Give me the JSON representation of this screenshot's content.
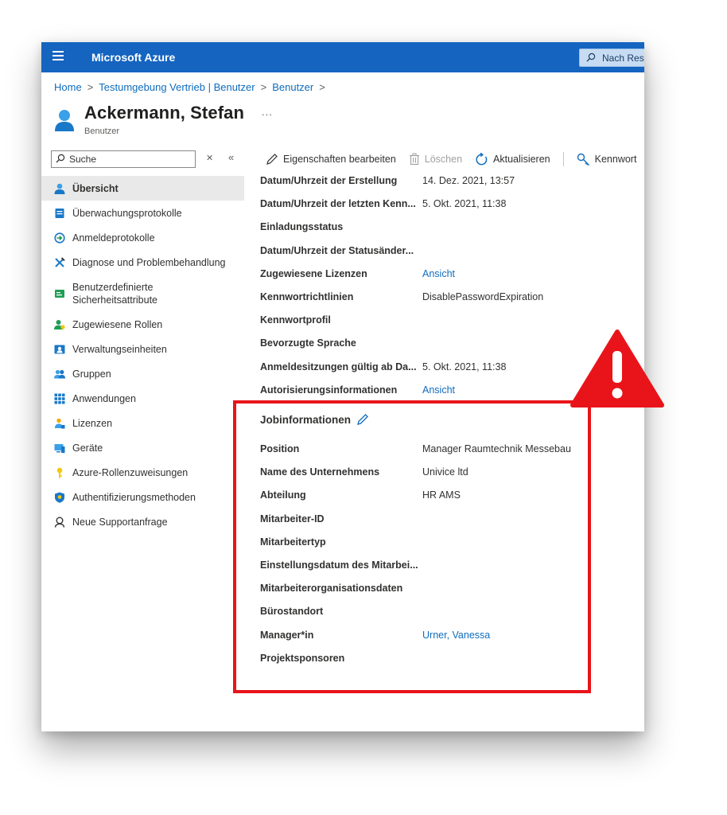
{
  "topbar": {
    "brand": "Microsoft Azure",
    "search_text": "Nach Res"
  },
  "breadcrumb": {
    "items": [
      "Home",
      "Testumgebung Vertrieb | Benutzer",
      "Benutzer"
    ]
  },
  "header": {
    "title": "Ackermann, Stefan",
    "subtitle": "Benutzer",
    "more": "..."
  },
  "sidebar": {
    "search_placeholder": "Suche",
    "clear": "✕",
    "collapse": "«",
    "items": [
      {
        "label": "Übersicht",
        "icon": "user-icon"
      },
      {
        "label": "Überwachungsprotokolle",
        "icon": "audit-log-icon"
      },
      {
        "label": "Anmeldeprotokolle",
        "icon": "sign-in-icon"
      },
      {
        "label": "Diagnose und Problembehandlung",
        "icon": "wrench-icon"
      },
      {
        "label_line1": "Benutzerdefinierte",
        "label_line2": "Sicherheitsattribute",
        "icon": "security-attributes-icon"
      },
      {
        "label": "Zugewiesene Rollen",
        "icon": "roles-icon"
      },
      {
        "label": "Verwaltungseinheiten",
        "icon": "admin-units-icon"
      },
      {
        "label": "Gruppen",
        "icon": "groups-icon"
      },
      {
        "label": "Anwendungen",
        "icon": "apps-grid-icon"
      },
      {
        "label": "Lizenzen",
        "icon": "licenses-icon"
      },
      {
        "label": "Geräte",
        "icon": "devices-icon"
      },
      {
        "label": "Azure-Rollenzuweisungen",
        "icon": "key-icon"
      },
      {
        "label": "Authentifizierungsmethoden",
        "icon": "shield-icon"
      },
      {
        "label": "Neue Supportanfrage",
        "icon": "support-icon"
      }
    ]
  },
  "toolbar": {
    "edit": "Eigenschaften bearbeiten",
    "delete": "Löschen",
    "refresh": "Aktualisieren",
    "password": "Kennwort"
  },
  "properties": [
    {
      "label": "Datum/Uhrzeit der Erstellung",
      "value": "14. Dez. 2021, 13:57"
    },
    {
      "label": "Datum/Uhrzeit der letzten Kenn...",
      "value": "5. Okt. 2021, 11:38"
    },
    {
      "label": "Einladungsstatus",
      "value": ""
    },
    {
      "label": "Datum/Uhrzeit der Statusänder...",
      "value": ""
    },
    {
      "label": "Zugewiesene Lizenzen",
      "value": "Ansicht"
    },
    {
      "label": "Kennwortrichtlinien",
      "value": "DisablePasswordExpiration"
    },
    {
      "label": "Kennwortprofil",
      "value": ""
    },
    {
      "label": "Bevorzugte Sprache",
      "value": ""
    },
    {
      "label": "Anmeldesitzungen gültig ab Da...",
      "value": "5. Okt. 2021, 11:38"
    },
    {
      "label": "Autorisierungsinformationen",
      "value": "Ansicht"
    }
  ],
  "job_section": {
    "title": "Jobinformationen"
  },
  "job_info": [
    {
      "label": "Position",
      "value": "Manager Raumtechnik Messebau"
    },
    {
      "label": "Name des Unternehmens",
      "value": "Univice ltd"
    },
    {
      "label": "Abteilung",
      "value": "HR AMS"
    },
    {
      "label": "Mitarbeiter-ID",
      "value": ""
    },
    {
      "label": "Mitarbeitertyp",
      "value": ""
    },
    {
      "label": "Einstellungsdatum des Mitarbei...",
      "value": ""
    },
    {
      "label": "Mitarbeiterorganisationsdaten",
      "value": ""
    },
    {
      "label": "Bürostandort",
      "value": ""
    },
    {
      "label": "Manager*in",
      "value": "Urner, Vanessa"
    },
    {
      "label": "Projektsponsoren",
      "value": ""
    }
  ],
  "colors": {
    "topbar": "#1464c0",
    "link": "#0f6cbd",
    "highlight": "#e8141a"
  }
}
